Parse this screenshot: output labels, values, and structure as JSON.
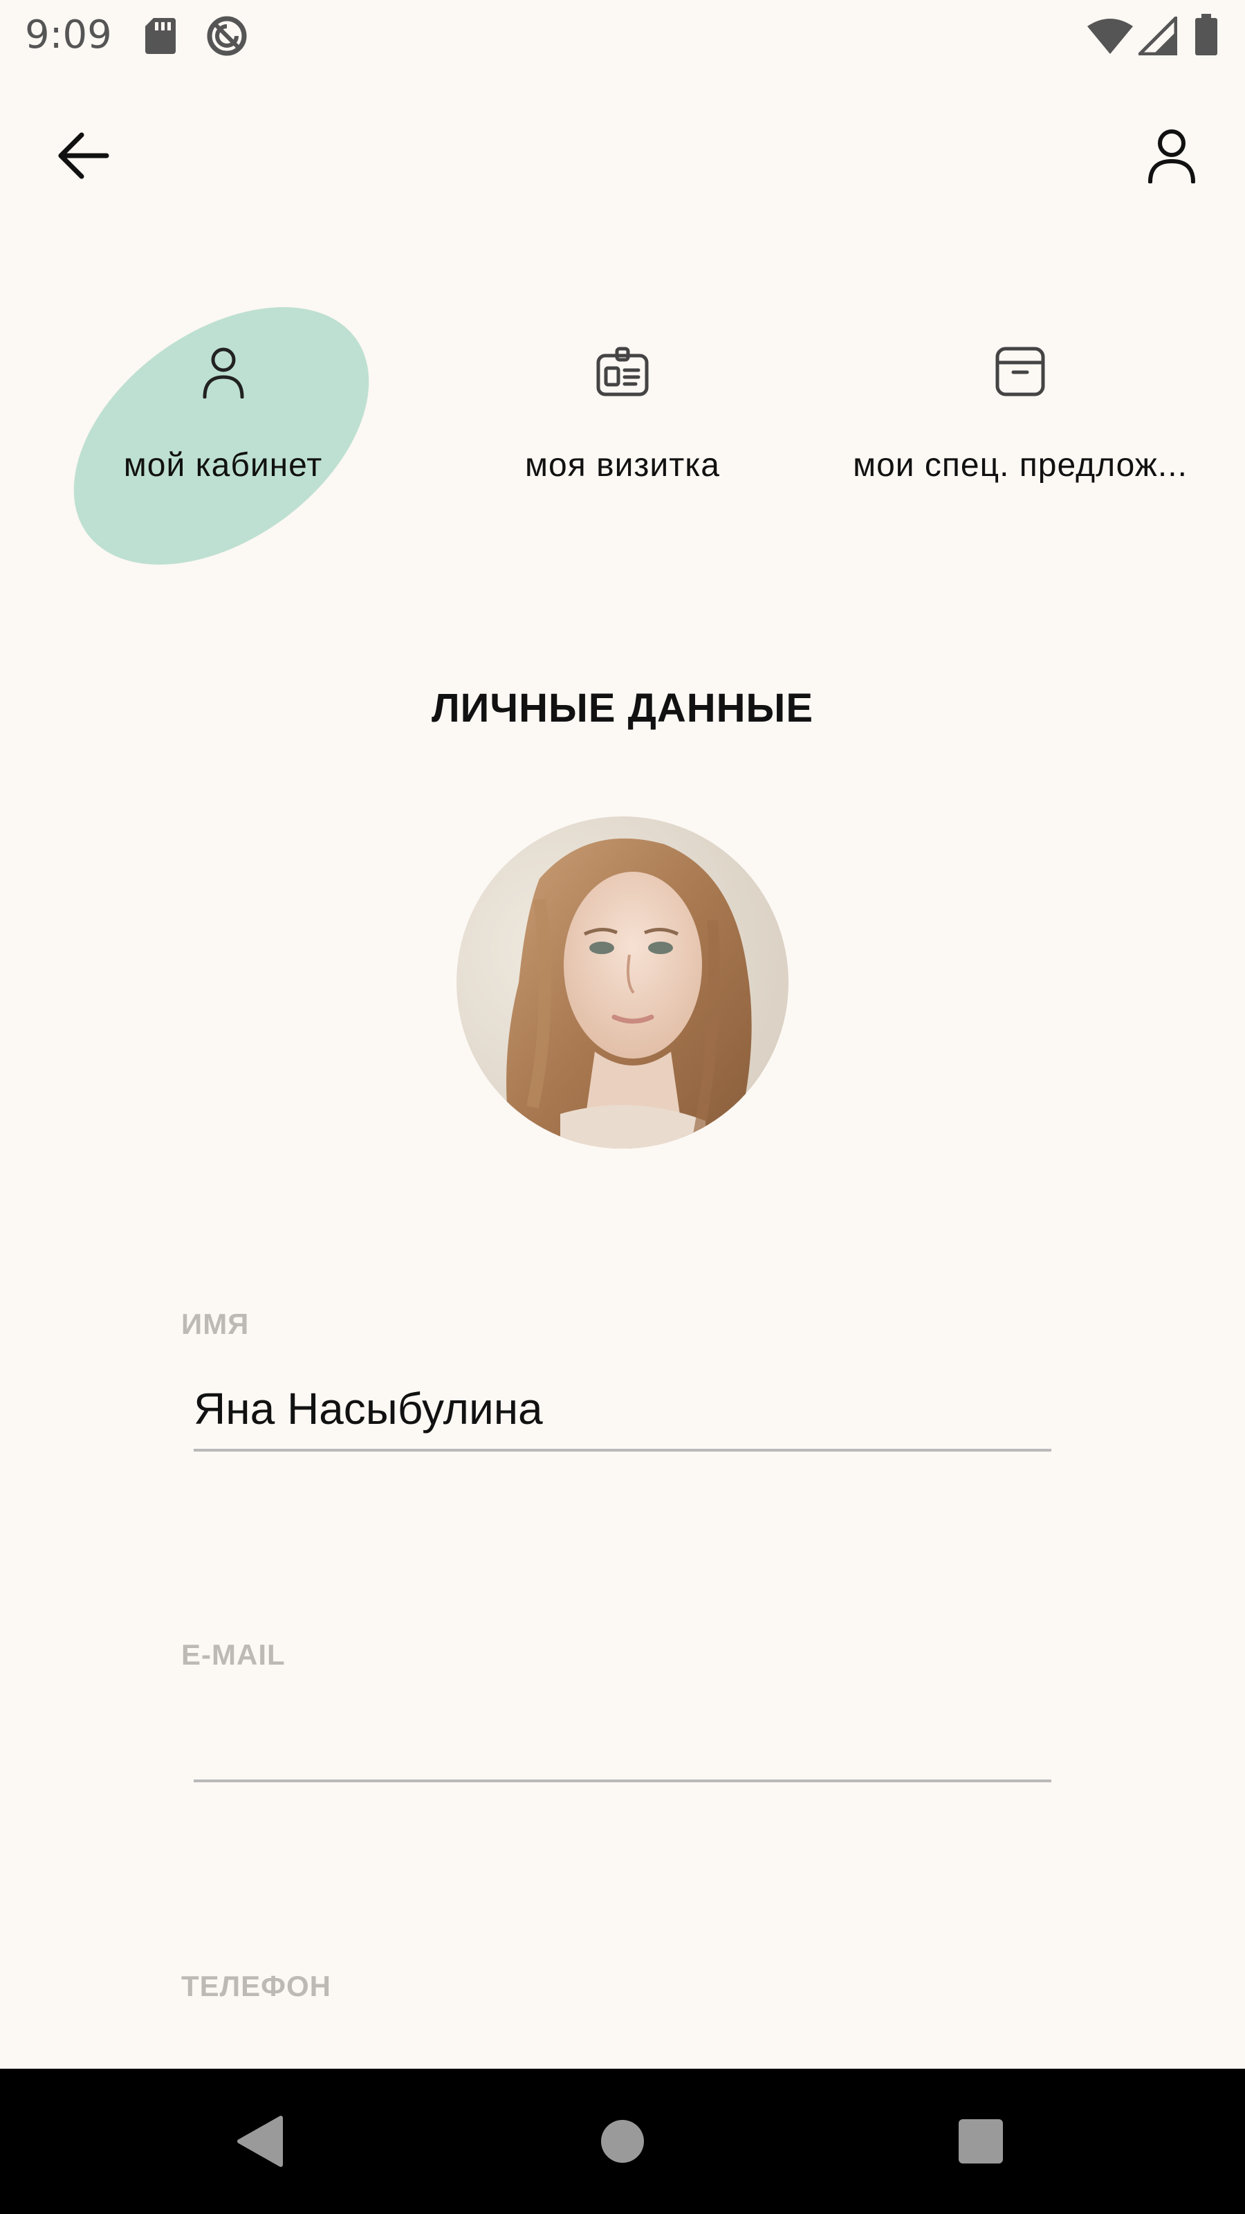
{
  "status_bar": {
    "time": "9:09",
    "icons": [
      "sd-card-icon",
      "sync-disabled-icon",
      "wifi-icon",
      "signal-icon",
      "battery-icon"
    ]
  },
  "app_bar": {
    "back_icon": "arrow-left-icon",
    "profile_icon": "user-icon"
  },
  "tabs": [
    {
      "label": "мой кабинет",
      "icon": "user-icon",
      "selected": true
    },
    {
      "label": "моя визитка",
      "icon": "id-badge-icon",
      "selected": false
    },
    {
      "label": "мои спец. предлож...",
      "icon": "archive-box-icon",
      "selected": false
    }
  ],
  "colors": {
    "background": "#FCF8F4",
    "tab_highlight": "#BEE0D2",
    "label_gray": "#BDBAB6"
  },
  "section_title": "ЛИЧНЫЕ ДАННЫЕ",
  "form": {
    "name": {
      "label": "ИМЯ",
      "value": "Яна Насыбулина"
    },
    "email": {
      "label": "E-MAIL",
      "value": ""
    },
    "phone": {
      "label": "ТЕЛЕФОН"
    }
  },
  "nav_bar": {
    "icons": [
      "back-triangle-icon",
      "home-circle-icon",
      "recents-square-icon"
    ]
  }
}
